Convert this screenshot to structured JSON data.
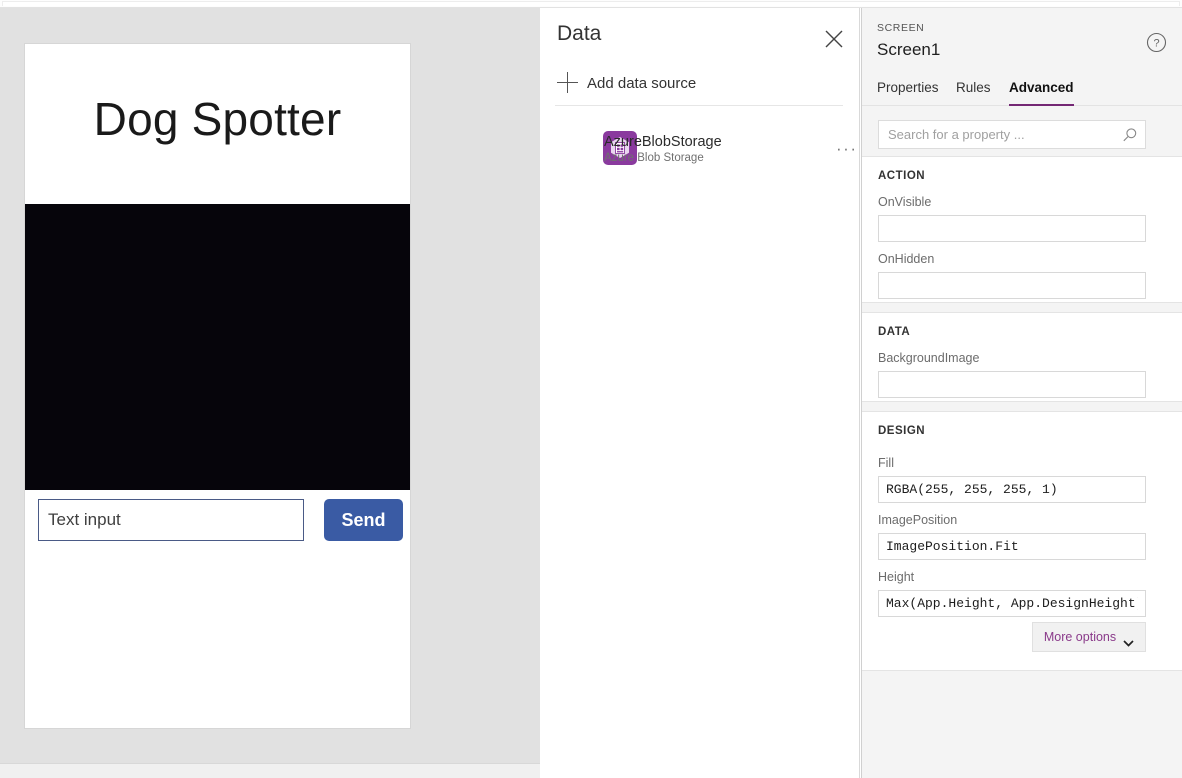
{
  "canvas": {
    "app_title": "Dog Spotter",
    "text_input_placeholder": "Text input",
    "text_input_value": "",
    "send_label": "Send",
    "media_color": "#06050b"
  },
  "data_panel": {
    "title": "Data",
    "close_icon": "close-icon",
    "add_data_source_label": "Add data source",
    "plus_icon": "plus-icon",
    "sources": [
      {
        "name": "AzureBlobStorage",
        "subtitle": "Azure Blob Storage",
        "icon": "azure-blob-storage-icon",
        "icon_color": "#8a3a9e",
        "overflow": "···"
      }
    ]
  },
  "properties_panel": {
    "kind_label": "SCREEN",
    "screen_name": "Screen1",
    "help_icon": "help-circle-icon",
    "tabs": [
      {
        "label": "Properties",
        "active": false
      },
      {
        "label": "Rules",
        "active": false
      },
      {
        "label": "Advanced",
        "active": true
      }
    ],
    "accent_color": "#742774",
    "search": {
      "placeholder": "Search for a property ...",
      "value": "",
      "icon": "search-icon"
    },
    "sections": [
      {
        "title": "ACTION",
        "fields": [
          {
            "label": "OnVisible",
            "value": ""
          },
          {
            "label": "OnHidden",
            "value": ""
          }
        ]
      },
      {
        "title": "DATA",
        "fields": [
          {
            "label": "BackgroundImage",
            "value": ""
          }
        ]
      },
      {
        "title": "DESIGN",
        "fields": [
          {
            "label": "Fill",
            "value": "RGBA(255, 255, 255, 1)"
          },
          {
            "label": "ImagePosition",
            "value": "ImagePosition.Fit"
          },
          {
            "label": "Height",
            "value": "Max(App.Height, App.DesignHeight)"
          }
        ]
      }
    ],
    "more_options": {
      "label": "More options",
      "icon": "chevron-down-icon"
    }
  }
}
